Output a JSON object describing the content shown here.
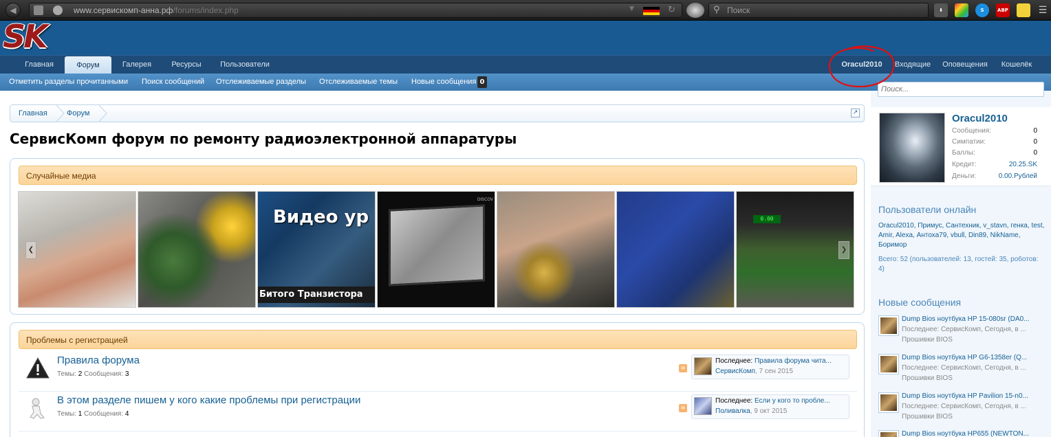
{
  "browser": {
    "url_host": "www.сервискомп-анна.рф",
    "url_path": "/forums/index.php",
    "search_placeholder": "Поиск",
    "ext_abp": "ABP"
  },
  "logo": {
    "text": "SK"
  },
  "nav": {
    "tabs": [
      "Главная",
      "Форум",
      "Галерея",
      "Ресурсы",
      "Пользователи"
    ],
    "active_tab": "Форум",
    "user_links": [
      "Oracul2010",
      "Входящие",
      "Оповещения",
      "Кошелёк"
    ]
  },
  "subnav": {
    "items": [
      "Отметить разделы прочитанными",
      "Поиск сообщений",
      "Отслеживаемые разделы",
      "Отслеживаемые темы",
      "Новые сообщения"
    ],
    "new_count": "0"
  },
  "breadcrumb": [
    "Главная",
    "Форум"
  ],
  "page_title": "СервисКомп форум по ремонту радиоэлектронной аппаратуры",
  "media": {
    "heading": "Случайные медиа",
    "overlay_top": "Видео ур",
    "overlay_bottom": "Битого Транзистора",
    "logo_tag": "DISCOV",
    "meter_readout": "0.00"
  },
  "category": {
    "heading": "Проблемы с регистрацией",
    "nodes": [
      {
        "title": "Правила форума",
        "threads_label": "Темы:",
        "threads": "2",
        "posts_label": "Сообщения:",
        "posts": "3",
        "last_label": "Последнее:",
        "last_title": "Правила форума чита...",
        "last_user": "СервисКомп",
        "last_date": ", 7 сен 2015"
      },
      {
        "title": "В этом разделе пишем у кого какие проблемы при регистрации",
        "threads_label": "Темы:",
        "threads": "1",
        "posts_label": "Сообщения:",
        "posts": "4",
        "last_label": "Последнее:",
        "last_title": "Если у кого то пробле...",
        "last_user": "Поливалка",
        "last_date": ", 9 окт 2015"
      }
    ]
  },
  "sidebar": {
    "search_placeholder": "Поиск...",
    "visitor": {
      "name": "Oracul2010",
      "stats": [
        {
          "label": "Сообщения:",
          "value": "0"
        },
        {
          "label": "Симпатии:",
          "value": "0"
        },
        {
          "label": "Баллы:",
          "value": "0"
        },
        {
          "label": "Кредит:",
          "value": "20.25.SK"
        },
        {
          "label": "Деньги:",
          "value": "0.00.Рублей"
        }
      ]
    },
    "online_heading": "Пользователи онлайн",
    "online_users": "Oracul2010, Примус, Сантехник, v_stavn, генка, test, Amir, Alexa, Антоха79, vbull, Din89, NikName, Боримор",
    "online_total": "Всего: 52 (пользователей: 13, гостей: 35, роботов: 4)",
    "new_posts_heading": "Новые сообщения",
    "new_posts": [
      {
        "title": "Dump Bios ноутбука HP 15-080sr (DA0...",
        "meta": "Последнее: СервисКомп, Сегодня, в ...",
        "forum": "Прошивки BIOS"
      },
      {
        "title": "Dump Bios ноутбука HP G6-1358er (Q...",
        "meta": "Последнее: СервисКомп, Сегодня, в ...",
        "forum": "Прошивки BIOS"
      },
      {
        "title": "Dump Bios ноутбука HP Pavilion 15-n0...",
        "meta": "Последнее: СервисКомп, Сегодня, в ...",
        "forum": "Прошивки BIOS"
      },
      {
        "title": "Dump Bios ноутбука HP655 (NEWTON...",
        "meta": "",
        "forum": ""
      }
    ]
  },
  "colors": {
    "header": "#185a91",
    "nav": "#1e4b78",
    "subnav": "#4a8ac1",
    "accent": "#176093",
    "annotation": "#e01010"
  }
}
